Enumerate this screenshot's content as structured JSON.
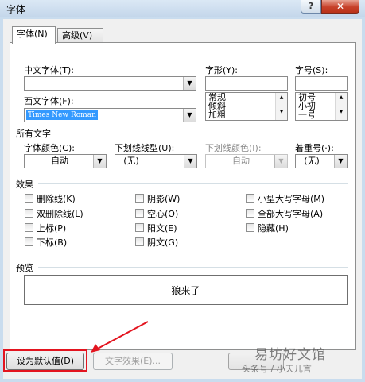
{
  "window": {
    "title": "字体",
    "help_label": "?",
    "close_label": "✕"
  },
  "tabs": [
    {
      "label": "字体(N)"
    },
    {
      "label": "高级(V)"
    }
  ],
  "font": {
    "chinese_font_label": "中文字体(T):",
    "chinese_font_value": "",
    "western_font_label": "西文字体(F):",
    "western_font_value": "Times New Roman",
    "style_label": "字形(Y):",
    "style_options": [
      "常规",
      "倾斜",
      "加粗"
    ],
    "size_label": "字号(S):",
    "size_options": [
      "初号",
      "小初",
      "一号"
    ]
  },
  "all_text": {
    "section_label": "所有文字",
    "font_color_label": "字体颜色(C):",
    "font_color_value": "自动",
    "underline_type_label": "下划线线型(U):",
    "underline_type_value": "(无)",
    "underline_color_label": "下划线颜色(I):",
    "underline_color_value": "自动",
    "emphasis_label": "着重号(·):",
    "emphasis_value": "(无)"
  },
  "effects": {
    "section_label": "效果",
    "items": [
      "删除线(K)",
      "双删除线(L)",
      "上标(P)",
      "下标(B)",
      "阴影(W)",
      "空心(O)",
      "阳文(E)",
      "阴文(G)",
      "小型大写字母(M)",
      "全部大写字母(A)",
      "隐藏(H)"
    ]
  },
  "preview": {
    "section_label": "预览",
    "sample_text": "狼来了"
  },
  "buttons": {
    "set_default": "设为默认值(D)",
    "text_effects": "文字效果(E)..."
  },
  "watermark": {
    "line1": "易坊好文馆",
    "line2": "头条号 / 小天儿言"
  },
  "colors": {
    "accent_red": "#e3141f",
    "selection": "#3399ff"
  }
}
